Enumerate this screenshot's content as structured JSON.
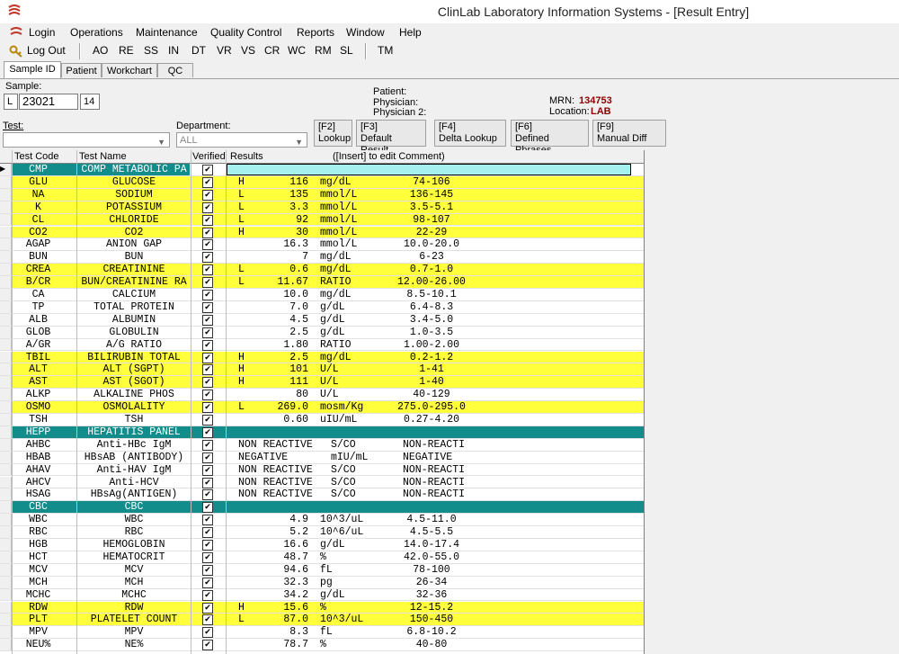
{
  "app": {
    "title": "ClinLab Laboratory Information Systems - [Result Entry]",
    "icon": "clinlab-logo-icon"
  },
  "menu": [
    "Login",
    "Operations",
    "Maintenance",
    "Quality Control",
    "Reports",
    "Window",
    "Help"
  ],
  "toolbar": {
    "logout": "Log Out",
    "buttons": [
      "AO",
      "RE",
      "SS",
      "IN",
      "DT",
      "VR",
      "VS",
      "CR",
      "WC",
      "RM",
      "SL"
    ],
    "tm": "TM"
  },
  "tabs": [
    "Sample ID",
    "Patient",
    "Workchart",
    "QC"
  ],
  "sample": {
    "label": "Sample:",
    "prefix": "L",
    "number": "23021",
    "suffix": "14"
  },
  "patient": {
    "patient_label": "Patient:",
    "physician_label": "Physician:",
    "physician2_label": "Physician 2:",
    "mrn_label": "MRN:",
    "mrn": "134753",
    "location_label": "Location:",
    "location": "LAB"
  },
  "filters": {
    "test_label": "Test:",
    "department_label": "Department:",
    "department_value": "ALL"
  },
  "fbuttons": [
    [
      "[F2]",
      "Lookup"
    ],
    [
      "[F3]",
      "Default Result"
    ],
    [
      "[F4]",
      "Delta Lookup"
    ],
    [
      "[F6]",
      "Defined Phrases"
    ],
    [
      "[F9]",
      "Manual Diff"
    ]
  ],
  "grid": {
    "headers": {
      "code": "Test Code",
      "name": "Test Name",
      "verified": "Verified",
      "results": "Results",
      "comment": "([Insert] to edit Comment)"
    },
    "rows": [
      {
        "code": "CMP",
        "name": "COMP METABOLIC PA",
        "flag": "",
        "value": "",
        "unit": "",
        "range": "",
        "style": "header-cmp"
      },
      {
        "code": "GLU",
        "name": "GLUCOSE",
        "flag": "H",
        "value": "116",
        "unit": "mg/dL",
        "range": "74-106",
        "style": "yellow"
      },
      {
        "code": "NA",
        "name": "SODIUM",
        "flag": "L",
        "value": "135",
        "unit": "mmol/L",
        "range": "136-145",
        "style": "yellow"
      },
      {
        "code": "K",
        "name": "POTASSIUM",
        "flag": "L",
        "value": "3.3",
        "unit": "mmol/L",
        "range": "3.5-5.1",
        "style": "yellow"
      },
      {
        "code": "CL",
        "name": "CHLORIDE",
        "flag": "L",
        "value": "92",
        "unit": "mmol/L",
        "range": "98-107",
        "style": "yellow"
      },
      {
        "code": "CO2",
        "name": "CO2",
        "flag": "H",
        "value": "30",
        "unit": "mmol/L",
        "range": "22-29",
        "style": "yellow"
      },
      {
        "code": "AGAP",
        "name": "ANION GAP",
        "flag": "",
        "value": "16.3",
        "unit": "mmol/L",
        "range": "10.0-20.0",
        "style": ""
      },
      {
        "code": "BUN",
        "name": "BUN",
        "flag": "",
        "value": "7",
        "unit": "mg/dL",
        "range": "6-23",
        "style": ""
      },
      {
        "code": "CREA",
        "name": "CREATININE",
        "flag": "L",
        "value": "0.6",
        "unit": "mg/dL",
        "range": "0.7-1.0",
        "style": "yellow"
      },
      {
        "code": "B/CR",
        "name": "BUN/CREATININE RA",
        "flag": "L",
        "value": "11.67",
        "unit": "RATIO",
        "range": "12.00-26.00",
        "style": "yellow"
      },
      {
        "code": "CA",
        "name": "CALCIUM",
        "flag": "",
        "value": "10.0",
        "unit": "mg/dL",
        "range": "8.5-10.1",
        "style": ""
      },
      {
        "code": "TP",
        "name": "TOTAL PROTEIN",
        "flag": "",
        "value": "7.0",
        "unit": "g/dL",
        "range": "6.4-8.3",
        "style": ""
      },
      {
        "code": "ALB",
        "name": "ALBUMIN",
        "flag": "",
        "value": "4.5",
        "unit": "g/dL",
        "range": "3.4-5.0",
        "style": ""
      },
      {
        "code": "GLOB",
        "name": "GLOBULIN",
        "flag": "",
        "value": "2.5",
        "unit": "g/dL",
        "range": "1.0-3.5",
        "style": ""
      },
      {
        "code": "A/GR",
        "name": "A/G RATIO",
        "flag": "",
        "value": "1.80",
        "unit": "RATIO",
        "range": "1.00-2.00",
        "style": ""
      },
      {
        "code": "TBIL",
        "name": "BILIRUBIN TOTAL",
        "flag": "H",
        "value": "2.5",
        "unit": "mg/dL",
        "range": "0.2-1.2",
        "style": "yellow"
      },
      {
        "code": "ALT",
        "name": "ALT (SGPT)",
        "flag": "H",
        "value": "101",
        "unit": "U/L",
        "range": "1-41",
        "style": "yellow"
      },
      {
        "code": "AST",
        "name": "AST (SGOT)",
        "flag": "H",
        "value": "111",
        "unit": "U/L",
        "range": "1-40",
        "style": "yellow"
      },
      {
        "code": "ALKP",
        "name": "ALKALINE PHOS",
        "flag": "",
        "value": "80",
        "unit": "U/L",
        "range": "40-129",
        "style": ""
      },
      {
        "code": "OSMO",
        "name": "OSMOLALITY",
        "flag": "L",
        "value": "269.0",
        "unit": "mosm/Kg",
        "range": "275.0-295.0",
        "style": "yellow"
      },
      {
        "code": "TSH",
        "name": "TSH",
        "flag": "",
        "value": "0.60",
        "unit": "uIU/mL",
        "range": "0.27-4.20",
        "style": ""
      },
      {
        "code": "HEPP",
        "name": "HEPATITIS PANEL",
        "flag": "",
        "value": "",
        "unit": "",
        "range": "",
        "style": "teal"
      },
      {
        "code": "AHBC",
        "name": "Anti-HBc IgM",
        "flag": "",
        "value": "NON REACTIVE",
        "unit": "S/CO",
        "range": "NON-REACTI",
        "style": "text"
      },
      {
        "code": "HBAB",
        "name": "HBsAB (ANTIBODY)",
        "flag": "",
        "value": "NEGATIVE",
        "unit": "mIU/mL",
        "range": "NEGATIVE",
        "style": "text"
      },
      {
        "code": "AHAV",
        "name": "Anti-HAV IgM",
        "flag": "",
        "value": "NON REACTIVE",
        "unit": "S/CO",
        "range": "NON-REACTI",
        "style": "text"
      },
      {
        "code": "AHCV",
        "name": "Anti-HCV",
        "flag": "",
        "value": "NON REACTIVE",
        "unit": "S/CO",
        "range": "NON-REACTI",
        "style": "text"
      },
      {
        "code": "HSAG",
        "name": "HBsAg(ANTIGEN)",
        "flag": "",
        "value": "NON REACTIVE",
        "unit": "S/CO",
        "range": "NON-REACTI",
        "style": "text"
      },
      {
        "code": "CBC",
        "name": "CBC",
        "flag": "",
        "value": "",
        "unit": "",
        "range": "",
        "style": "teal"
      },
      {
        "code": "WBC",
        "name": "WBC",
        "flag": "",
        "value": "4.9",
        "unit": "10^3/uL",
        "range": "4.5-11.0",
        "style": ""
      },
      {
        "code": "RBC",
        "name": "RBC",
        "flag": "",
        "value": "5.2",
        "unit": "10^6/uL",
        "range": "4.5-5.5",
        "style": ""
      },
      {
        "code": "HGB",
        "name": "HEMOGLOBIN",
        "flag": "",
        "value": "16.6",
        "unit": "g/dL",
        "range": "14.0-17.4",
        "style": ""
      },
      {
        "code": "HCT",
        "name": "HEMATOCRIT",
        "flag": "",
        "value": "48.7",
        "unit": "%",
        "range": "42.0-55.0",
        "style": ""
      },
      {
        "code": "MCV",
        "name": "MCV",
        "flag": "",
        "value": "94.6",
        "unit": "fL",
        "range": "78-100",
        "style": ""
      },
      {
        "code": "MCH",
        "name": "MCH",
        "flag": "",
        "value": "32.3",
        "unit": "pg",
        "range": "26-34",
        "style": ""
      },
      {
        "code": "MCHC",
        "name": "MCHC",
        "flag": "",
        "value": "34.2",
        "unit": "g/dL",
        "range": "32-36",
        "style": ""
      },
      {
        "code": "RDW",
        "name": "RDW",
        "flag": "H",
        "value": "15.6",
        "unit": "%",
        "range": "12-15.2",
        "style": "yellow"
      },
      {
        "code": "PLT",
        "name": "PLATELET COUNT",
        "flag": "L",
        "value": "87.0",
        "unit": "10^3/uL",
        "range": "150-450",
        "style": "yellow"
      },
      {
        "code": "MPV",
        "name": "MPV",
        "flag": "",
        "value": "8.3",
        "unit": "fL",
        "range": "6.8-10.2",
        "style": ""
      },
      {
        "code": "NEU%",
        "name": "NE%",
        "flag": "",
        "value": "78.7",
        "unit": "%",
        "range": "40-80",
        "style": ""
      }
    ]
  }
}
